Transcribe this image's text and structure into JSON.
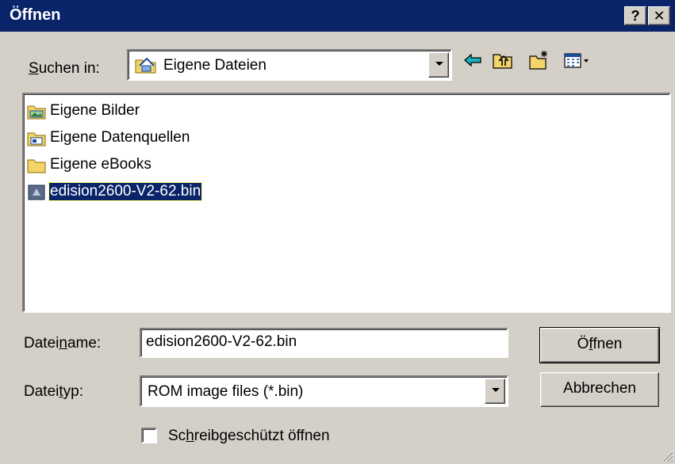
{
  "window": {
    "title": "Öffnen",
    "help_label": "?",
    "close_label": "✕"
  },
  "lookin": {
    "label_pre": "",
    "label_u": "S",
    "label_post": "uchen in:",
    "value": "Eigene Dateien"
  },
  "files": [
    {
      "name": "Eigene Bilder",
      "icon": "my-pictures-folder-icon"
    },
    {
      "name": "Eigene Datenquellen",
      "icon": "data-sources-folder-icon"
    },
    {
      "name": "Eigene eBooks",
      "icon": "folder-icon"
    },
    {
      "name": "edision2600-V2-62.bin",
      "icon": "bin-file-icon",
      "selected": true
    }
  ],
  "filename": {
    "label_pre": "Datei",
    "label_u": "n",
    "label_post": "ame:",
    "value": "edision2600-V2-62.bin"
  },
  "filetype": {
    "label_pre": "Datei",
    "label_u": "t",
    "label_post": "yp:",
    "value": "ROM image files (*.bin)"
  },
  "buttons": {
    "open_pre": "Ö",
    "open_u": "f",
    "open_post": "fnen",
    "cancel": "Abbrechen"
  },
  "readonly": {
    "label_pre": "Sc",
    "label_u": "h",
    "label_post": "reibgeschützt öffnen",
    "checked": false
  },
  "colors": {
    "titlebar": "#0a246a",
    "face": "#d4d0c8",
    "selection": "#0a246a"
  }
}
